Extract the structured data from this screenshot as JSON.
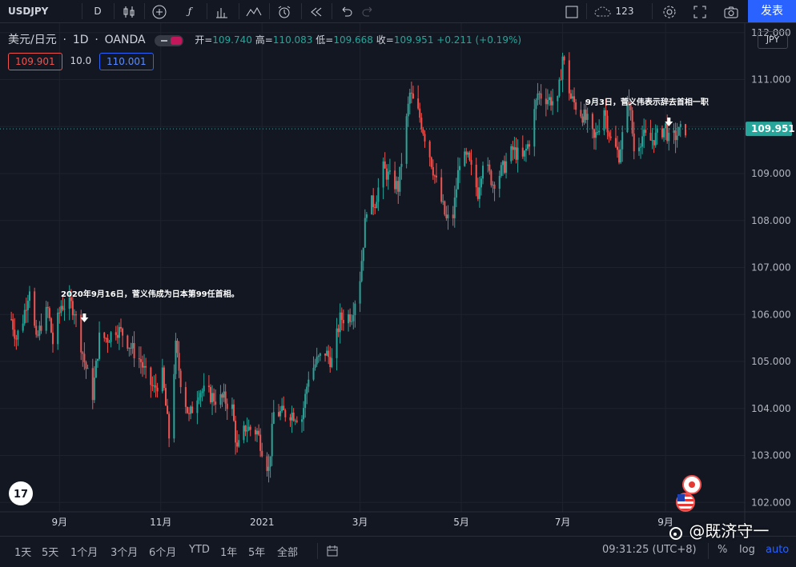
{
  "toolbar": {
    "symbol": "USDJPY",
    "interval": "D",
    "units_value": "123",
    "publish_label": "发表"
  },
  "legend": {
    "symbol_desc": "美元/日元",
    "interval": "1D",
    "exchange": "OANDA",
    "open_label": "开=",
    "open_value": "109.740",
    "high_label": "高=",
    "high_value": "110.083",
    "low_label": "低=",
    "low_value": "109.668",
    "close_label": "收=",
    "close_value": "109.951",
    "change": "+0.211 (+0.19%)"
  },
  "trade": {
    "sell": "109.901",
    "spread": "10.0",
    "buy": "110.001"
  },
  "currency_button": "JPY",
  "bottom": {
    "ranges": [
      "1天",
      "5天",
      "1个月",
      "3个月",
      "6个月",
      "YTD",
      "1年",
      "5年",
      "全部"
    ],
    "time": "09:31:25 (UTC+8)",
    "percent": "%",
    "log": "log",
    "auto": "auto"
  },
  "watermark": "@既济守一",
  "colors": {
    "background": "#131722",
    "up": "#26a69a",
    "down": "#ef5350",
    "accent": "#2962ff"
  },
  "chart_data": {
    "type": "candlestick",
    "symbol": "USDJPY",
    "title": "美元/日元 · 1D · OANDA",
    "y_axis": {
      "ticks": [
        "102.000",
        "103.000",
        "104.000",
        "105.000",
        "106.000",
        "107.000",
        "108.000",
        "109.000",
        "110.000",
        "111.000",
        "112.000"
      ],
      "ylim": [
        101.8,
        112.2
      ]
    },
    "x_axis": {
      "tick_labels": [
        "9月",
        "11月",
        "2021",
        "3月",
        "5月",
        "7月",
        "9月"
      ],
      "range": [
        "2020-08-01",
        "2021-09-13"
      ]
    },
    "last_price": "109.951",
    "series": [
      {
        "name": "close",
        "points": [
          [
            "2020-08-03",
            105.9
          ],
          [
            "2020-08-06",
            105.5
          ],
          [
            "2020-08-10",
            105.9
          ],
          [
            "2020-08-14",
            106.6
          ],
          [
            "2020-08-18",
            105.4
          ],
          [
            "2020-08-21",
            105.8
          ],
          [
            "2020-08-25",
            106.1
          ],
          [
            "2020-08-28",
            105.4
          ],
          [
            "2020-09-02",
            106.2
          ],
          [
            "2020-09-08",
            106.2
          ],
          [
            "2020-09-10",
            106.1
          ],
          [
            "2020-09-16",
            105.0
          ],
          [
            "2020-09-21",
            104.3
          ],
          [
            "2020-09-25",
            105.5
          ],
          [
            "2020-09-30",
            105.5
          ],
          [
            "2020-10-05",
            105.7
          ],
          [
            "2020-10-09",
            105.6
          ],
          [
            "2020-10-14",
            105.3
          ],
          [
            "2020-10-20",
            105.0
          ],
          [
            "2020-10-23",
            104.7
          ],
          [
            "2020-10-28",
            104.4
          ],
          [
            "2020-11-02",
            104.7
          ],
          [
            "2020-11-06",
            103.4
          ],
          [
            "2020-11-10",
            105.3
          ],
          [
            "2020-11-13",
            104.6
          ],
          [
            "2020-11-18",
            103.8
          ],
          [
            "2020-11-24",
            104.4
          ],
          [
            "2020-11-30",
            104.3
          ],
          [
            "2020-12-04",
            104.2
          ],
          [
            "2020-12-09",
            104.2
          ],
          [
            "2020-12-14",
            104.0
          ],
          [
            "2020-12-17",
            103.1
          ],
          [
            "2020-12-22",
            103.6
          ],
          [
            "2020-12-29",
            103.5
          ],
          [
            "2021-01-05",
            102.7
          ],
          [
            "2021-01-08",
            103.9
          ],
          [
            "2021-01-13",
            103.9
          ],
          [
            "2021-01-19",
            103.9
          ],
          [
            "2021-01-25",
            103.8
          ],
          [
            "2021-01-29",
            104.7
          ],
          [
            "2021-02-03",
            105.0
          ],
          [
            "2021-02-08",
            105.2
          ],
          [
            "2021-02-12",
            105.0
          ],
          [
            "2021-02-17",
            105.9
          ],
          [
            "2021-02-24",
            106.0
          ],
          [
            "2021-03-01",
            106.8
          ],
          [
            "2021-03-05",
            108.3
          ],
          [
            "2021-03-10",
            108.4
          ],
          [
            "2021-03-15",
            109.1
          ],
          [
            "2021-03-19",
            108.9
          ],
          [
            "2021-03-24",
            108.7
          ],
          [
            "2021-03-31",
            110.7
          ],
          [
            "2021-04-06",
            110.2
          ],
          [
            "2021-04-12",
            109.4
          ],
          [
            "2021-04-16",
            108.8
          ],
          [
            "2021-04-22",
            108.0
          ],
          [
            "2021-04-26",
            108.1
          ],
          [
            "2021-04-30",
            109.3
          ],
          [
            "2021-05-05",
            109.3
          ],
          [
            "2021-05-11",
            108.6
          ],
          [
            "2021-05-14",
            109.3
          ],
          [
            "2021-05-20",
            108.8
          ],
          [
            "2021-05-26",
            109.1
          ],
          [
            "2021-06-01",
            109.5
          ],
          [
            "2021-06-07",
            109.3
          ],
          [
            "2021-06-11",
            109.7
          ],
          [
            "2021-06-16",
            110.7
          ],
          [
            "2021-06-22",
            110.6
          ],
          [
            "2021-06-28",
            110.5
          ],
          [
            "2021-07-01",
            111.5
          ],
          [
            "2021-07-06",
            110.6
          ],
          [
            "2021-07-12",
            110.3
          ],
          [
            "2021-07-16",
            110.1
          ],
          [
            "2021-07-20",
            109.7
          ],
          [
            "2021-07-26",
            110.4
          ],
          [
            "2021-07-30",
            109.7
          ],
          [
            "2021-08-04",
            109.4
          ],
          [
            "2021-08-10",
            110.6
          ],
          [
            "2021-08-13",
            109.5
          ],
          [
            "2021-08-18",
            109.8
          ],
          [
            "2021-08-23",
            109.7
          ],
          [
            "2021-08-27",
            109.8
          ],
          [
            "2021-09-01",
            110.0
          ],
          [
            "2021-09-03",
            109.7
          ],
          [
            "2021-09-07",
            109.8
          ],
          [
            "2021-09-10",
            109.9
          ],
          [
            "2021-09-13",
            109.951
          ]
        ]
      }
    ],
    "annotations": [
      {
        "date": "2020-09-16",
        "text": "2020年9月16日，菅义伟成为日本第99任首相。"
      },
      {
        "date": "2021-09-03",
        "text": "9月3日，菅义伟表示辞去首相一职"
      }
    ],
    "grid": true
  }
}
